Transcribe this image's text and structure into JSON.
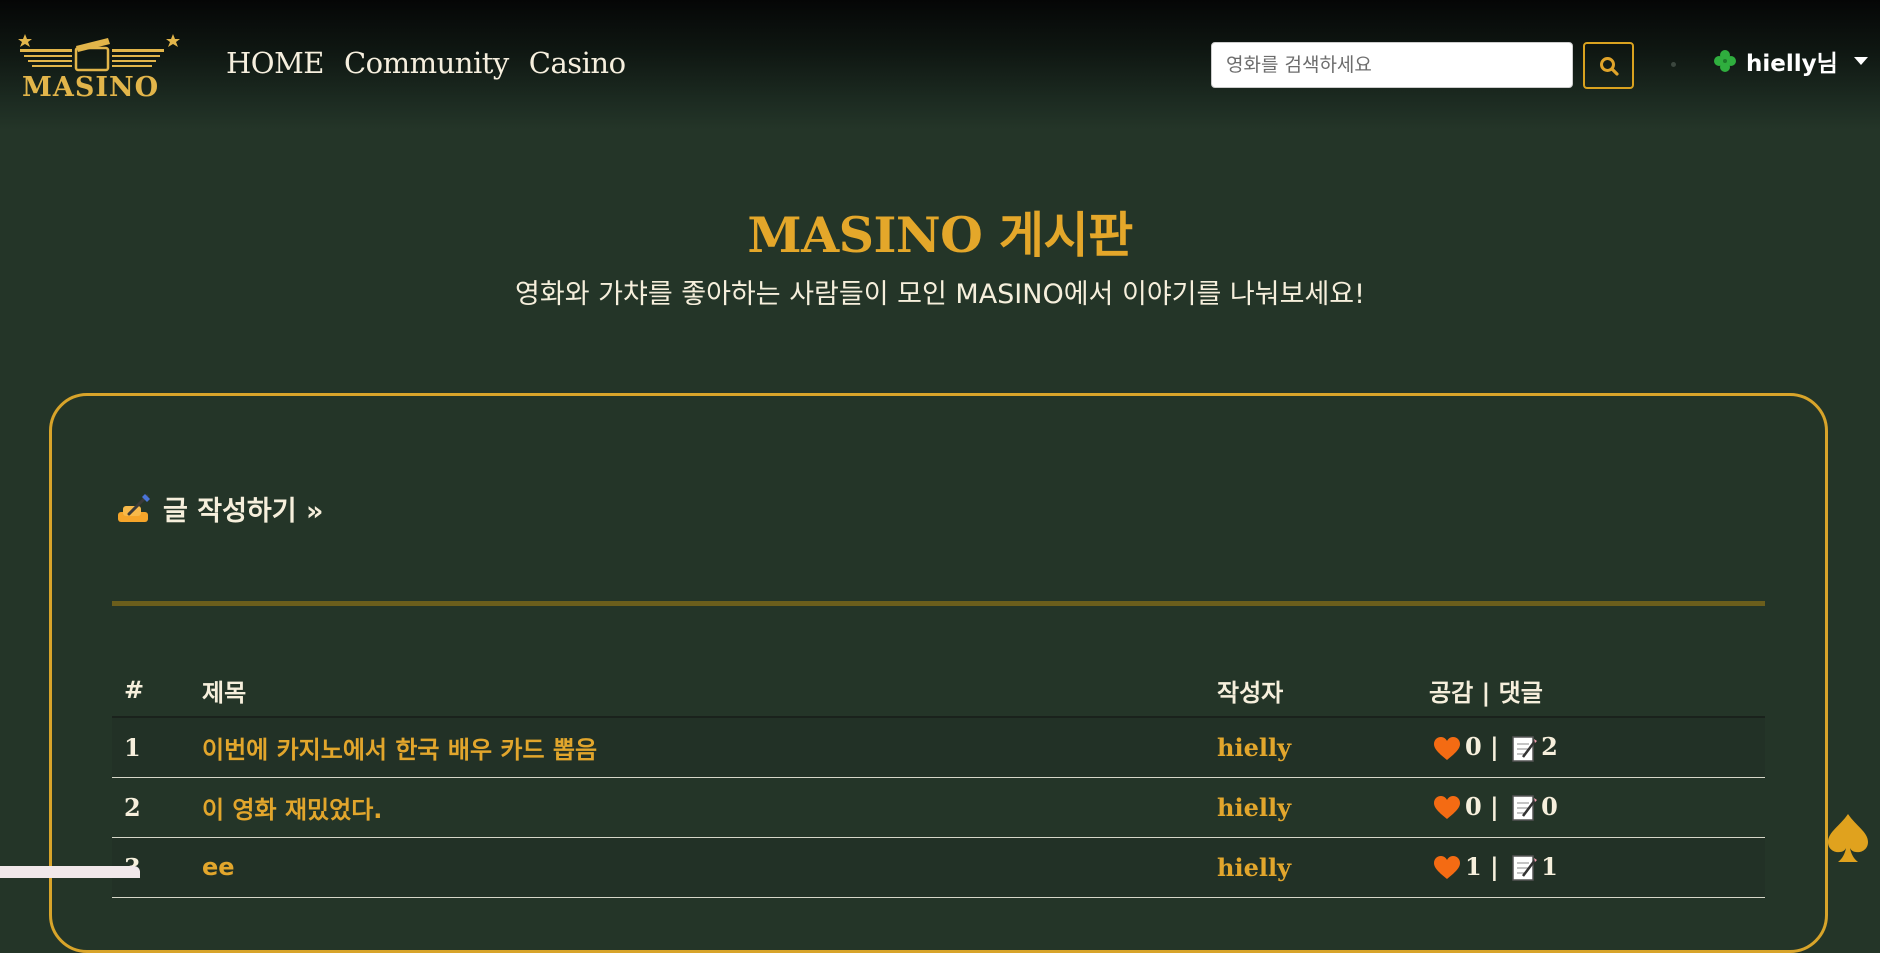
{
  "brand": {
    "name": "MASINO"
  },
  "nav": {
    "links": [
      "HOME",
      "Community",
      "Casino"
    ]
  },
  "search": {
    "placeholder": "영화를 검색하세요"
  },
  "user": {
    "name": "hielly님"
  },
  "hero": {
    "title": "MASINO 게시판",
    "subtitle": "영화와 가챠를 좋아하는 사람들이 모인 MASINO에서 이야기를 나눠보세요!"
  },
  "board": {
    "write_label": "글 작성하기 »",
    "columns": {
      "num": "#",
      "title": "제목",
      "author": "작성자",
      "stats": "공감 | 댓글"
    },
    "rows": [
      {
        "num": "1",
        "title": "이번에 카지노에서 한국 배우 카드 뽑음",
        "author": "hielly",
        "likes": "0",
        "comments": "2"
      },
      {
        "num": "2",
        "title": "이 영화 재밌었다.",
        "author": "hielly",
        "likes": "0",
        "comments": "0"
      },
      {
        "num": "3",
        "title": "ee",
        "author": "hielly",
        "likes": "1",
        "comments": "1"
      }
    ]
  },
  "colors": {
    "accent": "#e4a72a",
    "background": "#243528",
    "heart": "#f46b13"
  },
  "icons": [
    "film-logo-icon",
    "search-icon",
    "clover-icon",
    "writing-hand-icon",
    "heart-icon",
    "memo-icon",
    "spade-icon"
  ]
}
